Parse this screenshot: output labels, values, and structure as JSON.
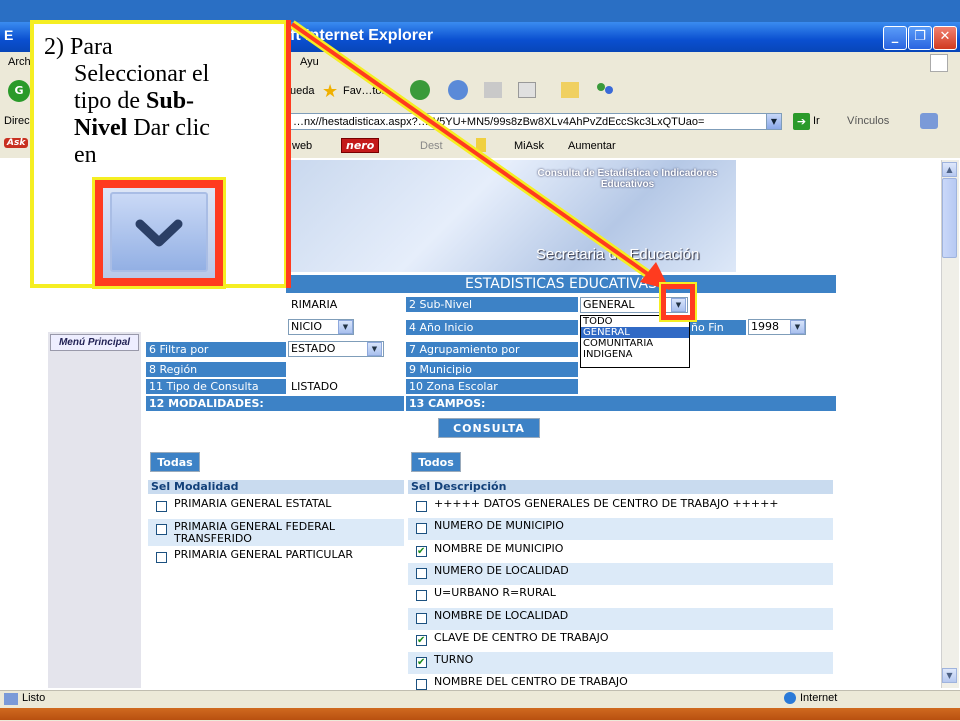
{
  "window": {
    "title": "ft Internet Explorer",
    "title_prefix": "E",
    "controls": [
      "_",
      "❐",
      "✕"
    ]
  },
  "menubar": {
    "items": [
      "Arch",
      "Ayu"
    ]
  },
  "toolbar": {
    "left_label": "ueda",
    "favorites_label": "Fav…tos",
    "left_edge": "G"
  },
  "address": {
    "label": "Direc",
    "value": "…nx//hestadisticax.aspx?…W5YU+MN5/99s8zBw8XLv4AhPvZdEccSkc3LxQTUao=",
    "go_label": "Ir",
    "links_label": "Vínculos"
  },
  "linksbar": {
    "items": [
      "web",
      "nero",
      "Dest",
      "MiAsk",
      "Aumentar"
    ],
    "left_edge": "Ask"
  },
  "banner": {
    "subtitle": "Consulta de Estadística e Indicadores Educativos",
    "title": "Secretaria de Educación"
  },
  "form": {
    "header": "ESTADISTICAS EDUCATIVAS",
    "menu_principal": "Menú Principal",
    "nivel_value": "RIMARIA",
    "subnivel_label": "2 Sub-Nivel",
    "subnivel_value": "GENERAL",
    "subnivel_options": [
      "TODO",
      "GENERAL",
      "COMUNITARIA",
      "INDIGENA"
    ],
    "ano_inicio_value": "NICIO",
    "ano_inicio_label": "4 Año Inicio",
    "ano_fin_label": "ño Fin",
    "ano_fin_value": "1998",
    "filtra_label": "6 Filtra por",
    "filtra_value": "ESTADO",
    "agrupamiento_label": "7 Agrupamiento por",
    "region_label": "8 Región",
    "municipio_label": "9 Municipio",
    "tipo_consulta_label": "11 Tipo de Consulta",
    "tipo_consulta_value": "LISTADO",
    "zona_label": "10 Zona Escolar",
    "modalidades_label": "12 MODALIDADES:",
    "campos_label": "13 CAMPOS:",
    "consulta_button": "CONSULTA",
    "todas_button": "Todas",
    "todos_button": "Todos",
    "modalidad_headers": {
      "sel": "Sel",
      "name": "Modalidad"
    },
    "campos_headers": {
      "sel": "Sel",
      "name": "Descripción"
    },
    "modalidades": [
      {
        "label": "PRIMARIA GENERAL ESTATAL",
        "checked": false
      },
      {
        "label": "PRIMARIA GENERAL FEDERAL TRANSFERIDO",
        "checked": false
      },
      {
        "label": "PRIMARIA GENERAL PARTICULAR",
        "checked": false
      }
    ],
    "campos": [
      {
        "label": "+++++ DATOS GENERALES DE CENTRO DE TRABAJO +++++",
        "checked": false
      },
      {
        "label": "NUMERO DE MUNICIPIO",
        "checked": false
      },
      {
        "label": "NOMBRE DE MUNICIPIO",
        "checked": true
      },
      {
        "label": "NUMERO DE LOCALIDAD",
        "checked": false
      },
      {
        "label": "U=URBANO R=RURAL",
        "checked": false
      },
      {
        "label": "NOMBRE DE LOCALIDAD",
        "checked": false
      },
      {
        "label": "CLAVE DE CENTRO DE TRABAJO",
        "checked": true
      },
      {
        "label": "TURNO",
        "checked": true
      },
      {
        "label": "NOMBRE DEL CENTRO DE TRABAJO",
        "checked": false
      }
    ]
  },
  "status": {
    "text": "Listo",
    "zone": "Internet"
  },
  "callout": {
    "line1": "2) Para",
    "line2": "Seleccionar el",
    "line3": "tipo de ",
    "line3_bold": "Sub-",
    "line4_bold": "Nivel",
    "line4": " Dar clic",
    "line5": "en"
  },
  "colors": {
    "accent": "#3d82c6",
    "annotation_red": "#ff3b1f",
    "annotation_yellow": "#f5ee22"
  }
}
